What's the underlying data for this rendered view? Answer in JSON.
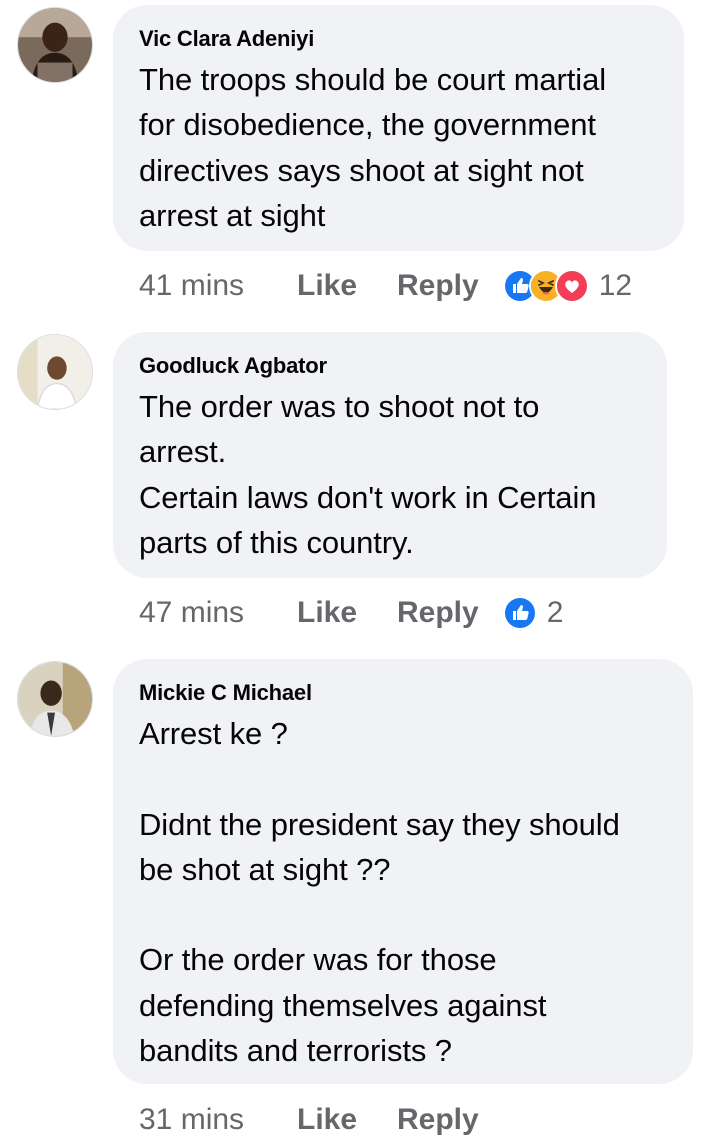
{
  "comments": [
    {
      "author": "Vic Clara Adeniyi",
      "text": "The troops should be court martial\nfor disobedience, the government\ndirectives says shoot at sight  not\narrest at sight",
      "time": "41 mins",
      "like_label": "Like",
      "reply_label": "Reply",
      "reactions": [
        "like-icon",
        "haha-icon",
        "love-icon"
      ],
      "reaction_count": "12"
    },
    {
      "author": "Goodluck Agbator",
      "text": "The order was to shoot not to\narrest.\nCertain laws don't work in Certain\nparts of this country.",
      "time": "47 mins",
      "like_label": "Like",
      "reply_label": "Reply",
      "reactions": [
        "like-icon"
      ],
      "reaction_count": "2"
    },
    {
      "author": "Mickie C Michael",
      "text": "Arrest ke ?\n\nDidnt the president say they should\nbe shot at sight ??\n\nOr the order was for those\ndefending themselves against\nbandits and terrorists ?",
      "time": "31 mins",
      "like_label": "Like",
      "reply_label": "Reply",
      "reactions": [],
      "reaction_count": ""
    }
  ],
  "colors": {
    "bubble": "#f0f2f5",
    "meta_text": "#65676b",
    "like_blue": "#1877f2",
    "haha_yellow": "#f7b125",
    "love_red": "#f33e58"
  }
}
